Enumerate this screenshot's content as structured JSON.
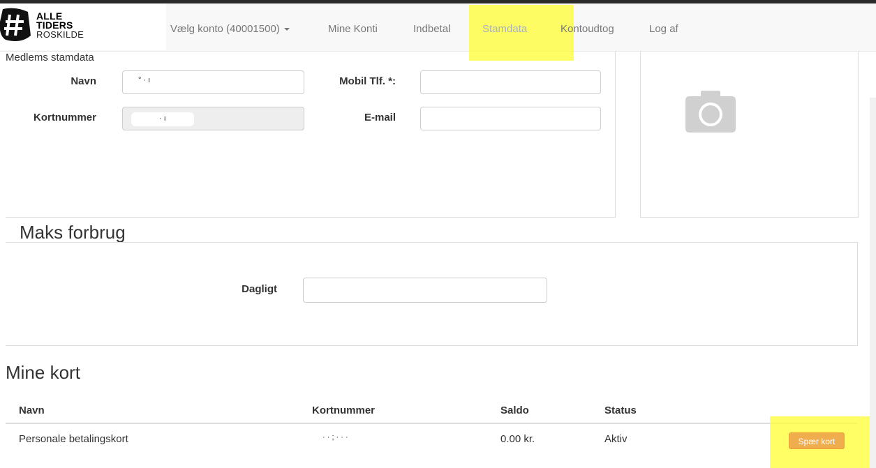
{
  "brand": {
    "line1": "ALLE",
    "line2": "TIDERS",
    "line3": "ROSKILDE",
    "symbol": "#"
  },
  "nav": {
    "account_selector": "Vælg konto (40001500)",
    "items": [
      "Mine Konti",
      "Indbetal",
      "Stamdata",
      "Kontoudtog",
      "Log af"
    ],
    "active": "Stamdata"
  },
  "member": {
    "section_title": "Medlems stamdata",
    "name_label": "Navn",
    "name_value": "° · ı",
    "card_label": "Kortnummer",
    "card_value": "· ı",
    "mobile_label": "Mobil Tlf. *:",
    "mobile_value": "",
    "email_label": "E-mail",
    "email_value": "",
    "photo_icon": "camera-icon"
  },
  "limits": {
    "title": "Maks forbrug",
    "daily_label": "Dagligt",
    "daily_value": ""
  },
  "cards": {
    "title": "Mine kort",
    "columns": [
      "Navn",
      "Kortnummer",
      "Saldo",
      "Status"
    ],
    "rows": [
      {
        "name": "Personale betalingskort",
        "number": "· · ; · · ·",
        "balance": "0.00 kr.",
        "status": "Aktiv",
        "action": "Spær kort"
      }
    ]
  },
  "colors": {
    "highlight": "#ffff32",
    "button": "#f0ad4e",
    "nav_bg": "#f8f8f8"
  }
}
